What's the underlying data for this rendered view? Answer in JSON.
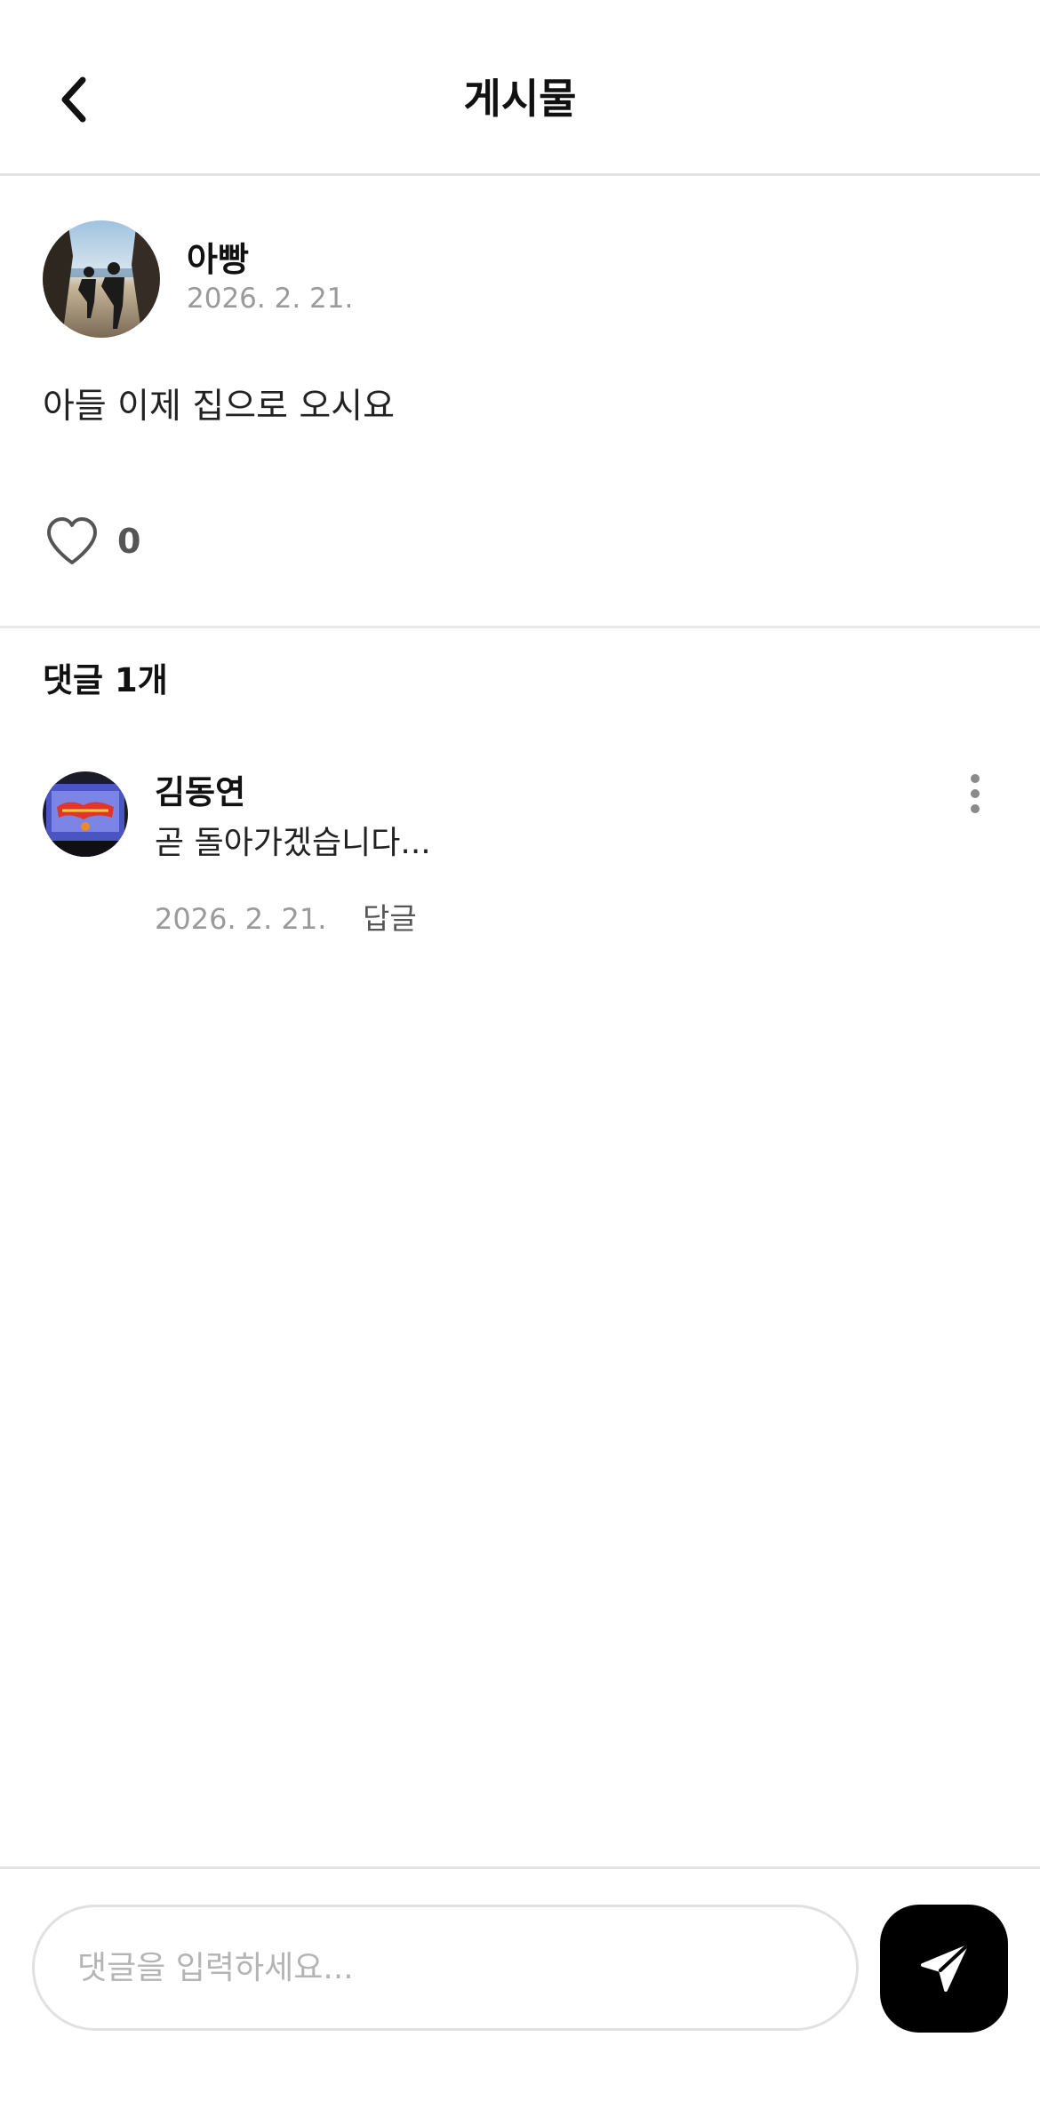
{
  "header": {
    "title": "게시물",
    "back_icon": "chevron-left-icon"
  },
  "post": {
    "author": "아빵",
    "date": "2026. 2. 21.",
    "content": "아들 이제 집으로 오시요",
    "like_icon": "heart-outline-icon",
    "like_count": "0"
  },
  "comments": {
    "header": "댓글 1개",
    "items": [
      {
        "author": "김동연",
        "text": "곧 돌아가겠습니다...",
        "date": "2026. 2. 21.",
        "reply_label": "답글",
        "more_icon": "more-vertical-icon"
      }
    ]
  },
  "input_bar": {
    "placeholder": "댓글을 입력하세요...",
    "value": "",
    "send_icon": "send-icon",
    "send_button_color": "#000000"
  }
}
